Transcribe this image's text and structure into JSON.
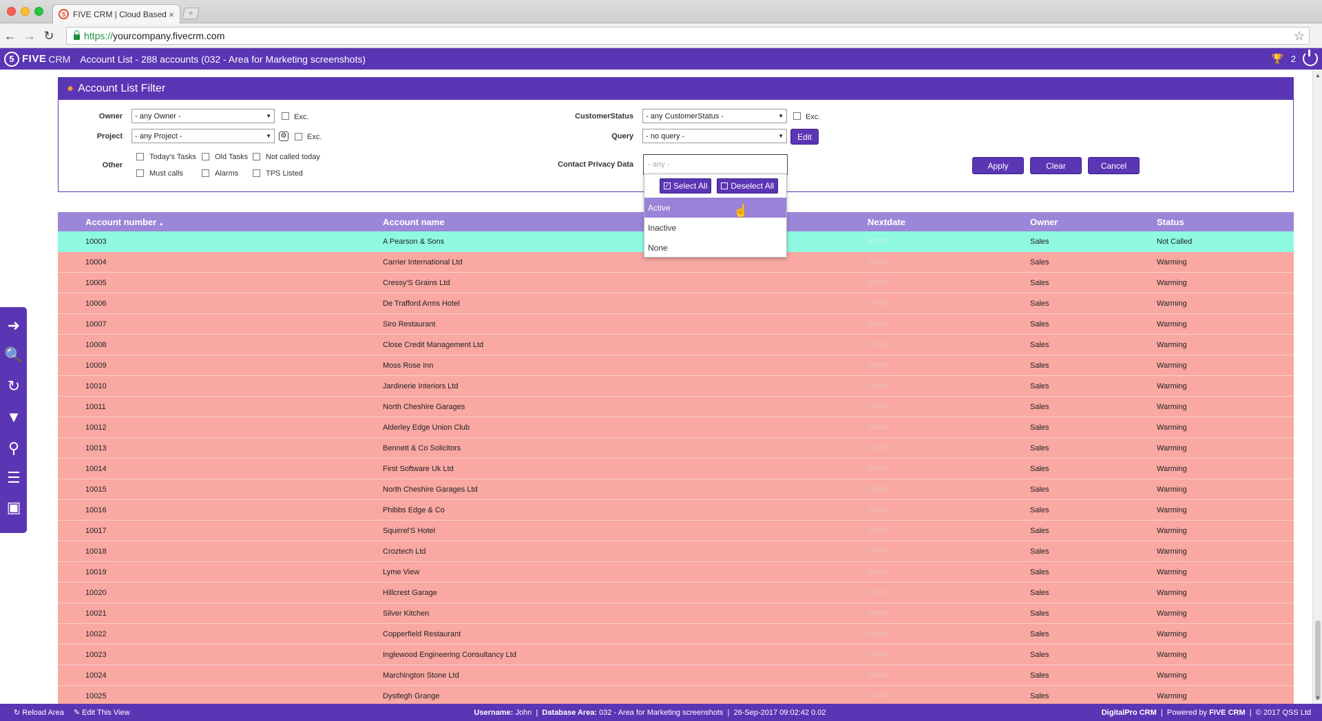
{
  "browser": {
    "tab_title": "FIVE CRM | Cloud Based Sa",
    "tab_close": "×",
    "new_tab": "+",
    "url_scheme": "https://",
    "url_host": "yourcompany.fivecrm.com"
  },
  "header": {
    "logo_mark": "5",
    "logo_five": "FIVE",
    "logo_crm": "CRM",
    "title": "Account List - 288 accounts (032 - Area for Marketing screenshots)",
    "trophy_count": "2"
  },
  "filter": {
    "title": "Account List Filter",
    "owner_label": "Owner",
    "owner_value": "- any Owner -",
    "project_label": "Project",
    "project_value": "- any Project -",
    "exc_label": "Exc.",
    "other_label": "Other",
    "other_options": [
      "Today's Tasks",
      "Old Tasks",
      "Not called today",
      "Must calls",
      "Alarms",
      "TPS Listed"
    ],
    "customer_status_label": "CustomerStatus",
    "customer_status_value": "- any CustomerStatus -",
    "query_label": "Query",
    "query_value": "- no query -",
    "edit_label": "Edit",
    "privacy_label": "Contact Privacy Data",
    "privacy_placeholder": "- any -",
    "apply_label": "Apply",
    "clear_label": "Clear",
    "cancel_label": "Cancel"
  },
  "dropdown": {
    "select_all": "Select All",
    "deselect_all": "Deselect All",
    "options": [
      "Active",
      "Inactive",
      "None"
    ],
    "highlighted": "Active"
  },
  "table": {
    "columns": [
      "Account number",
      "Account name",
      "Nextdate",
      "Owner",
      "Status"
    ],
    "sort_indicator": "▲",
    "rows": [
      {
        "num": "10003",
        "name": "A Pearson & Sons",
        "next": "(none)",
        "owner": "Sales",
        "status": "Not Called"
      },
      {
        "num": "10004",
        "name": "Carrier International Ltd",
        "next": "(none)",
        "owner": "Sales",
        "status": "Warming"
      },
      {
        "num": "10005",
        "name": "Cressy'S Grains Ltd",
        "next": "(none)",
        "owner": "Sales",
        "status": "Warming"
      },
      {
        "num": "10006",
        "name": "De Trafford Arms Hotel",
        "next": "(none)",
        "owner": "Sales",
        "status": "Warming"
      },
      {
        "num": "10007",
        "name": "Siro Restaurant",
        "next": "(none)",
        "owner": "Sales",
        "status": "Warming"
      },
      {
        "num": "10008",
        "name": "Close Credit Management Ltd",
        "next": "(none)",
        "owner": "Sales",
        "status": "Warming"
      },
      {
        "num": "10009",
        "name": "Moss Rose Inn",
        "next": "(none)",
        "owner": "Sales",
        "status": "Warming"
      },
      {
        "num": "10010",
        "name": "Jardinerie Interiors Ltd",
        "next": "(none)",
        "owner": "Sales",
        "status": "Warming"
      },
      {
        "num": "10011",
        "name": "North Cheshire Garages",
        "next": "(none)",
        "owner": "Sales",
        "status": "Warming"
      },
      {
        "num": "10012",
        "name": "Alderley Edge Union Club",
        "next": "(none)",
        "owner": "Sales",
        "status": "Warming"
      },
      {
        "num": "10013",
        "name": "Bennett & Co Solicitors",
        "next": "(none)",
        "owner": "Sales",
        "status": "Warming"
      },
      {
        "num": "10014",
        "name": "First Software Uk Ltd",
        "next": "(none)",
        "owner": "Sales",
        "status": "Warming"
      },
      {
        "num": "10015",
        "name": "North Cheshire Garages Ltd",
        "next": "(none)",
        "owner": "Sales",
        "status": "Warming"
      },
      {
        "num": "10016",
        "name": "Phibbs Edge & Co",
        "next": "(none)",
        "owner": "Sales",
        "status": "Warming"
      },
      {
        "num": "10017",
        "name": "Squirrel'S Hotel",
        "next": "(none)",
        "owner": "Sales",
        "status": "Warming"
      },
      {
        "num": "10018",
        "name": "Croztech Ltd",
        "next": "(none)",
        "owner": "Sales",
        "status": "Warming"
      },
      {
        "num": "10019",
        "name": "Lyme View",
        "next": "(none)",
        "owner": "Sales",
        "status": "Warming"
      },
      {
        "num": "10020",
        "name": "Hillcrest Garage",
        "next": "(none)",
        "owner": "Sales",
        "status": "Warming"
      },
      {
        "num": "10021",
        "name": "Silver Kitchen",
        "next": "(none)",
        "owner": "Sales",
        "status": "Warming"
      },
      {
        "num": "10022",
        "name": "Copperfield Restaurant",
        "next": "(none)",
        "owner": "Sales",
        "status": "Warming"
      },
      {
        "num": "10023",
        "name": "Inglewood Engineering Consultancy Ltd",
        "next": "(none)",
        "owner": "Sales",
        "status": "Warming"
      },
      {
        "num": "10024",
        "name": "Marchington Stone Ltd",
        "next": "(none)",
        "owner": "Sales",
        "status": "Warming"
      },
      {
        "num": "10025",
        "name": "Dystlegh Grange",
        "next": "(none)",
        "owner": "Sales",
        "status": "Warming"
      }
    ]
  },
  "footer": {
    "reload": "Reload Area",
    "edit_view": "Edit This View",
    "username_label": "Username:",
    "username": "John",
    "db_label": "Database Area:",
    "db_value": "032 - Area for Marketing screenshots",
    "datetime": "26-Sep-2017 09:02:42 0.02",
    "sep": "|",
    "right_brand": "DigitalPro CRM",
    "powered": "Powered by",
    "powered_brand": "FIVE CRM",
    "copyright": "© 2017 QSS Ltd"
  },
  "colors": {
    "brand": "#5a35b4",
    "row_warming": "#f9a8a2",
    "row_selected": "#8ef9e0",
    "header_row": "#9b87d9"
  },
  "icons": {
    "left_toolbar": [
      "go-arrow-icon",
      "quick-find-icon",
      "refresh-r-icon",
      "filter-off-icon",
      "search-off-icon",
      "import-list-icon",
      "report-icon"
    ]
  }
}
